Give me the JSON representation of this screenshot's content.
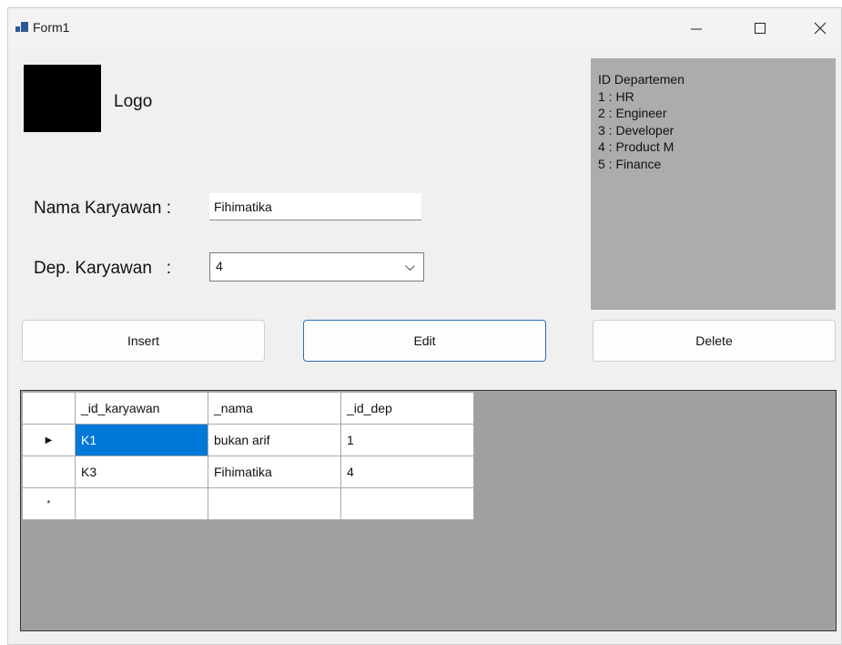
{
  "window": {
    "title": "Form1"
  },
  "logo": {
    "label": "Logo"
  },
  "info_panel": {
    "lines": [
      "ID Departemen",
      "1 : HR",
      "2 : Engineer",
      "3 : Developer",
      "4 : Product M",
      "5 : Finance"
    ]
  },
  "form": {
    "nama_label": "Nama Karyawan :",
    "nama_value": "Fihimatika",
    "dep_label": "Dep. Karyawan   :",
    "dep_value": "4"
  },
  "buttons": {
    "insert": "Insert",
    "edit": "Edit",
    "delete": "Delete"
  },
  "grid": {
    "columns": [
      "_id_karyawan",
      "_nama",
      "_id_dep"
    ],
    "rows": [
      [
        "K1",
        "bukan arif",
        "1"
      ],
      [
        "K3",
        "Fihimatika",
        "4"
      ]
    ],
    "current_row_marker": "▶",
    "new_row_marker": "*"
  },
  "icons": {
    "app": "app-form-icon",
    "minimize": "minimize-icon",
    "maximize": "maximize-icon",
    "close": "close-icon",
    "dropdown": "chevron-down-icon"
  },
  "colors": {
    "selection": "#0078d7",
    "info_panel_bg": "#acacac",
    "grid_bg": "#a0a0a0",
    "focus_border": "#2e6fb7"
  }
}
